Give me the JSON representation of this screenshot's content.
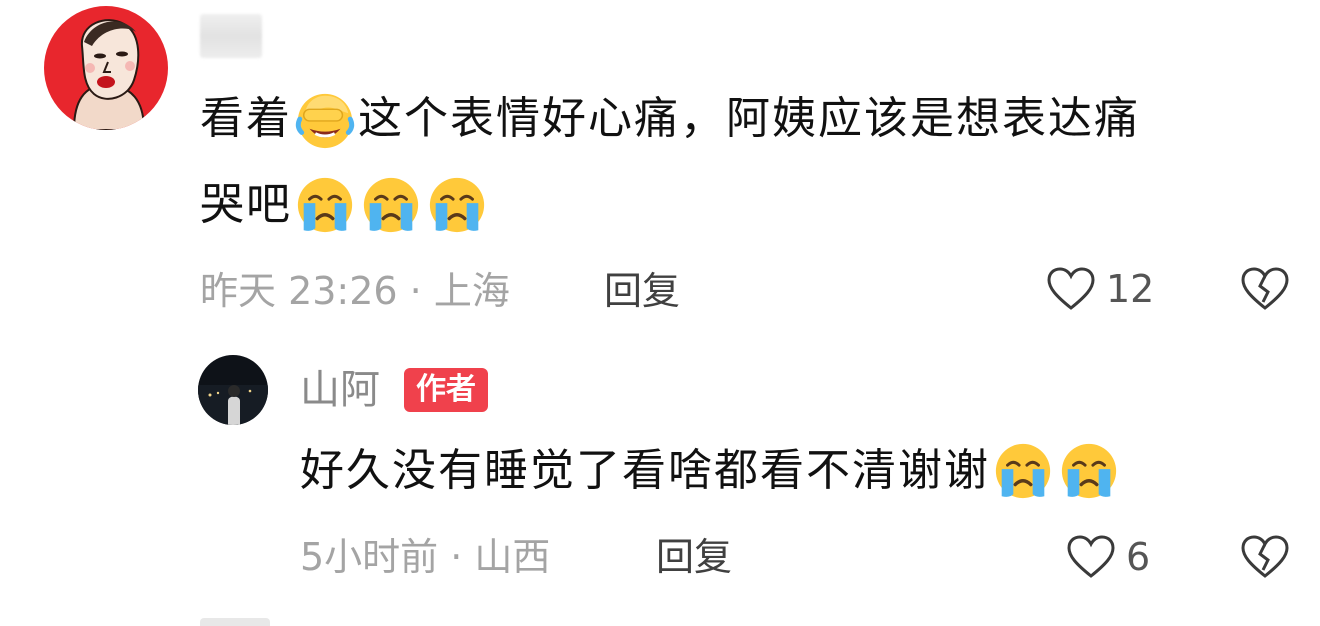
{
  "comments": [
    {
      "avatar_icon": "cartoon-face-avatar",
      "text_part1": "看着",
      "emoji_1": "facepalm-laugh-emoji",
      "text_part2": "这个表情好心痛，阿姨应该是想表达痛",
      "text_line2": "哭吧",
      "line2_emojis": [
        "crying-emoji",
        "crying-emoji",
        "crying-emoji"
      ],
      "meta": "昨天 23:26 · 上海",
      "reply_label": "回复",
      "like_count": "12"
    }
  ],
  "reply": {
    "avatar_icon": "night-scene-avatar",
    "username": "山阿",
    "badge": "作者",
    "text": "好久没有睡觉了看啥都看不清谢谢",
    "emojis": [
      "crying-emoji",
      "crying-emoji"
    ],
    "meta": "5小时前 · 山西",
    "reply_label": "回复",
    "like_count": "6"
  },
  "colors": {
    "badge": "#f0414c",
    "meta_text": "#a4a4a4",
    "body_text": "#111111"
  }
}
